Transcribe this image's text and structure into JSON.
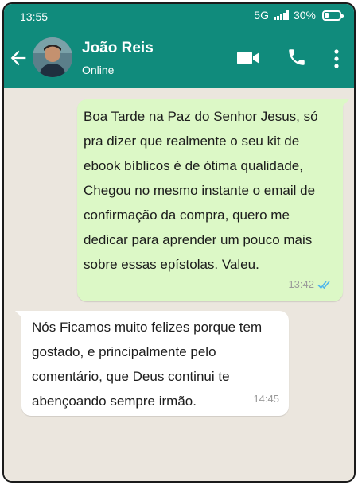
{
  "status_bar": {
    "time": "13:55",
    "network": "5G",
    "battery_percent": "30%",
    "battery_level": 0.3
  },
  "header": {
    "contact_name": "João Reis",
    "contact_status": "Online",
    "back_icon": "arrow-left-icon",
    "video_icon": "video-camera-icon",
    "call_icon": "phone-icon",
    "menu_icon": "more-vertical-icon"
  },
  "messages": [
    {
      "direction": "outgoing",
      "text": "Boa Tarde na Paz do Senhor Jesus, só pra dizer que realmente o seu kit de ebook bíblicos é de ótima qualidade, Chegou no mesmo instante o email de confirmação da compra, quero me dedicar para aprender um pouco mais sobre essas epístolas. Valeu.",
      "time": "13:42",
      "status": "read"
    },
    {
      "direction": "incoming",
      "text": "Nós Ficamos muito felizes porque tem gostado, e principalmente pelo comentário, que Deus continui te abençoando sempre irmão.",
      "time": "14:45"
    }
  ],
  "colors": {
    "header": "#108b7c",
    "chat_background": "#ebe6de",
    "outgoing_bubble": "#dcf8c6",
    "incoming_bubble": "#ffffff",
    "read_ticks": "#4fb6ec"
  }
}
